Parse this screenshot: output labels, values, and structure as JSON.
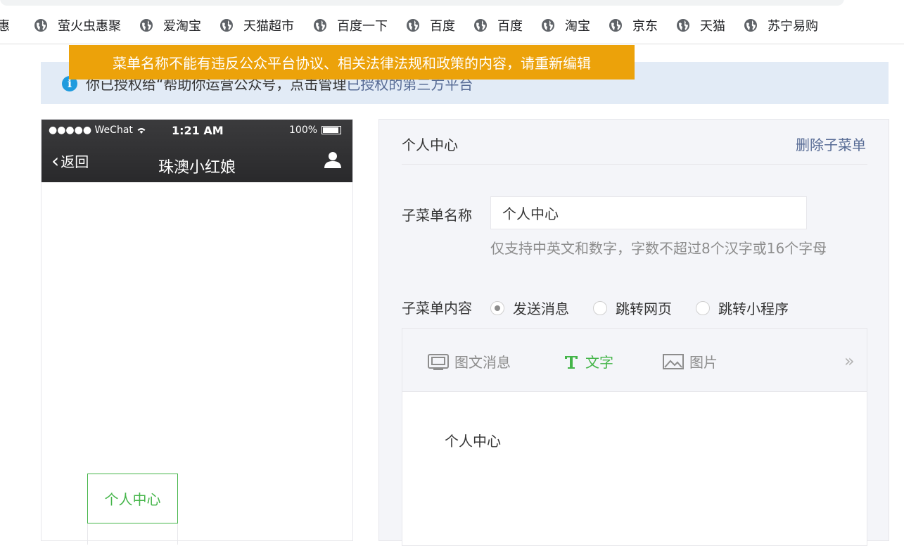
{
  "bookmarks": [
    {
      "label": "惠"
    },
    {
      "label": "萤火虫惠聚"
    },
    {
      "label": "爱淘宝"
    },
    {
      "label": "天猫超市"
    },
    {
      "label": "百度一下"
    },
    {
      "label": "百度"
    },
    {
      "label": "百度"
    },
    {
      "label": "淘宝"
    },
    {
      "label": "京东"
    },
    {
      "label": "天猫"
    },
    {
      "label": "苏宁易购"
    }
  ],
  "toast": "菜单名称不能有违反公众平台协议、相关法律法规和政策的内容，请重新编辑",
  "info": {
    "text": "你已授权给“帮助你运营公众号，点击管理",
    "link": "已授权的第三方平台"
  },
  "phone": {
    "carrier": "●●●●● WeChat",
    "time": "1:21 AM",
    "battery": "100%",
    "back": "返回",
    "title": "珠澳小红娘",
    "menu_button": "个人中心"
  },
  "editor": {
    "title": "个人中心",
    "delete_label": "删除子菜单",
    "name_label": "子菜单名称",
    "name_value": "个人中心",
    "name_hint": "仅支持中英文和数字，字数不超过8个汉字或16个字母",
    "content_label": "子菜单内容",
    "radios": [
      {
        "label": "发送消息",
        "checked": true
      },
      {
        "label": "跳转网页",
        "checked": false
      },
      {
        "label": "跳转小程序",
        "checked": false
      }
    ],
    "tabs": [
      {
        "label": "图文消息",
        "icon": "news-icon"
      },
      {
        "label": "文字",
        "icon": "text-icon",
        "active": true
      },
      {
        "label": "图片",
        "icon": "image-icon"
      }
    ],
    "more": "»",
    "message_text": "个人中心"
  },
  "colors": {
    "accent_green": "#44b549",
    "toast_orange": "#eca20a",
    "link_blue": "#576b95",
    "info_bg": "#e2ebf6"
  }
}
